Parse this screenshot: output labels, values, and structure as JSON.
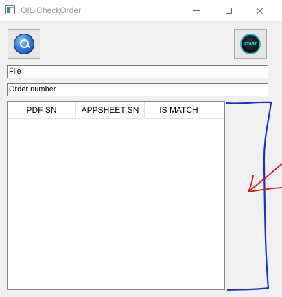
{
  "window": {
    "title": "OIL-CheckOrder"
  },
  "toolbar": {
    "search_button_icon": "search-orb-icon",
    "start_button_icon": "start-orb-icon",
    "start_label": "START"
  },
  "fields": {
    "file_value": "File",
    "order_value": "Order number"
  },
  "table": {
    "columns": [
      "PDF SN",
      "APPSHEET SN",
      "IS MATCH"
    ],
    "rows": []
  },
  "annotation": {
    "outline_color": "#1a2fd0",
    "arrow_color": "#e01010"
  }
}
